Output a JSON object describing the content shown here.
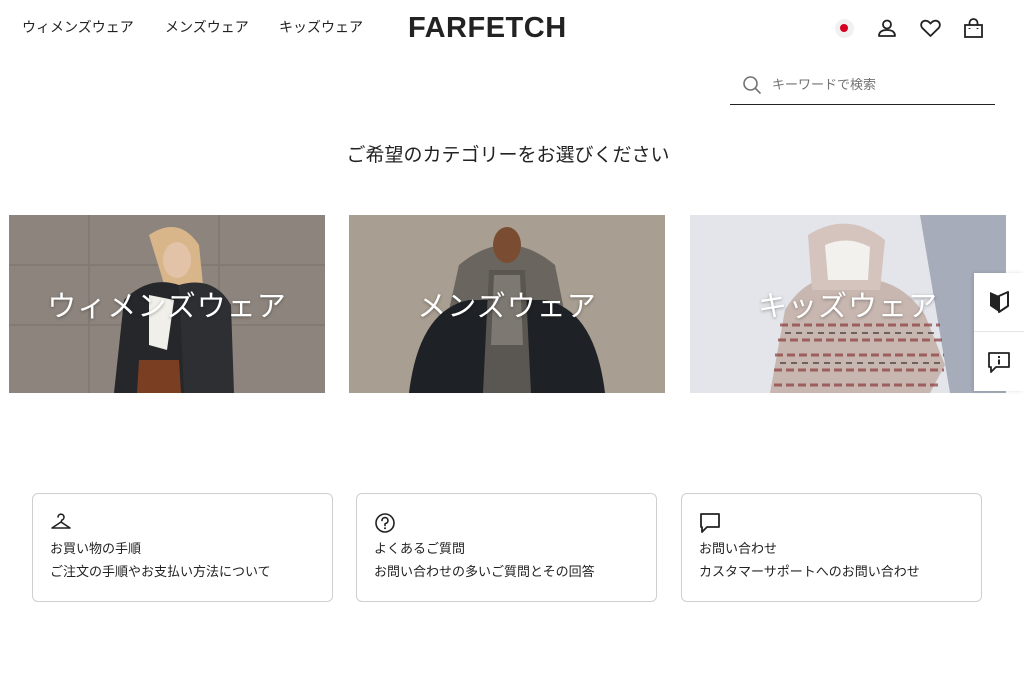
{
  "header": {
    "nav": [
      "ウィメンズウェア",
      "メンズウェア",
      "キッズウェア"
    ],
    "logo": "FARFETCH",
    "icons": [
      "japan-flag-icon",
      "account-icon",
      "wishlist-heart-icon",
      "shopping-bag-icon"
    ]
  },
  "search": {
    "placeholder": "キーワードで検索",
    "icon": "search-icon"
  },
  "prompt": "ご希望のカテゴリーをお選びください",
  "categories": [
    {
      "label": "ウィメンズウェア"
    },
    {
      "label": "メンズウェア"
    },
    {
      "label": "キッズウェア"
    }
  ],
  "side_buttons": [
    "beginner-mark-icon",
    "feedback-icon"
  ],
  "help_cards": [
    {
      "icon": "hanger-icon",
      "title": "お買い物の手順",
      "desc": "ご注文の手順やお支払い方法について"
    },
    {
      "icon": "question-circle-icon",
      "title": "よくあるご質問",
      "desc": "お問い合わせの多いご質問とその回答"
    },
    {
      "icon": "chat-bubble-icon",
      "title": "お問い合わせ",
      "desc": "カスタマーサポートへのお問い合わせ"
    }
  ],
  "colors": {
    "text": "#222222",
    "placeholder": "#727272",
    "border": "#cfcfcf",
    "flag_red": "#d60020"
  }
}
